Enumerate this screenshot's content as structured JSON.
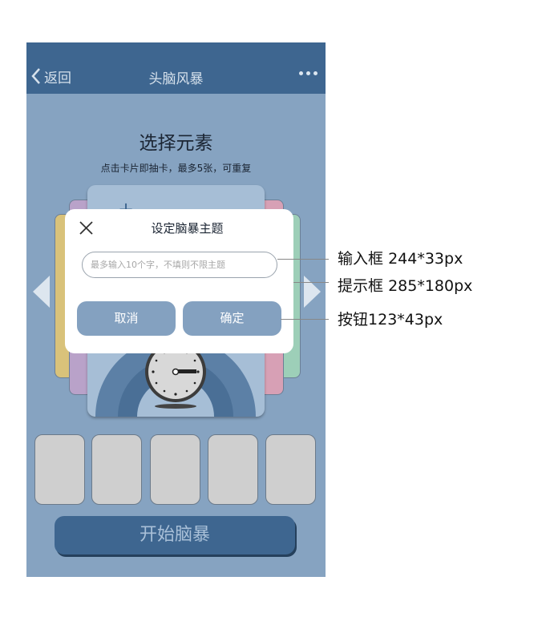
{
  "navbar": {
    "back_label": "返回",
    "title": "头脑风暴"
  },
  "content": {
    "title": "选择元素",
    "subtitle": "点击卡片即抽卡，最多5张，可重复",
    "start_button": "开始脑暴",
    "slots_count": 5
  },
  "dialog": {
    "title": "设定脑暴主题",
    "input_placeholder": "最多输入10个字，不填则不限主题",
    "input_value": "",
    "cancel_label": "取消",
    "confirm_label": "确定"
  },
  "annotations": [
    {
      "label": "输入框",
      "spec": "244*33px"
    },
    {
      "label": "提示框",
      "spec": "285*180px"
    },
    {
      "label": "按钮",
      "spec": "123*43px"
    }
  ],
  "colors": {
    "navbar": "#3e6690",
    "background": "#86a3c1",
    "dialog_button": "#84a1c0",
    "card_yellow": "#d9c27a",
    "card_purple": "#b9a2c9",
    "card_pink": "#d7a0b5",
    "card_green": "#9dcfb8"
  }
}
